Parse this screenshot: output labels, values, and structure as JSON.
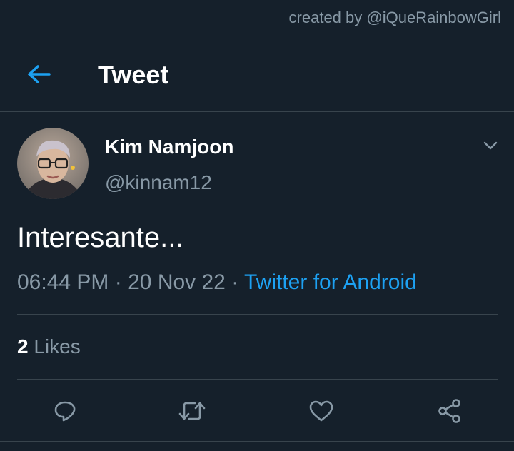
{
  "watermark": "created by @iQueRainbowGirl",
  "header": {
    "title": "Tweet",
    "back_icon": "arrow-left-icon"
  },
  "tweet": {
    "author_name": "Kim Namjoon",
    "author_handle": "@kinnam12",
    "text": "Interesante...",
    "time": "06:44 PM",
    "separator": "·",
    "date": "20 Nov 22",
    "source": "Twitter for Android"
  },
  "stats": {
    "likes_count": "2",
    "likes_label": "Likes"
  },
  "actions": {
    "reply_icon": "reply-icon",
    "retweet_icon": "retweet-icon",
    "like_icon": "heart-icon",
    "share_icon": "share-icon"
  },
  "colors": {
    "background": "#15202b",
    "divider": "#38444d",
    "secondary_text": "#8899a6",
    "accent": "#1da1f2",
    "primary_text": "#ffffff"
  }
}
